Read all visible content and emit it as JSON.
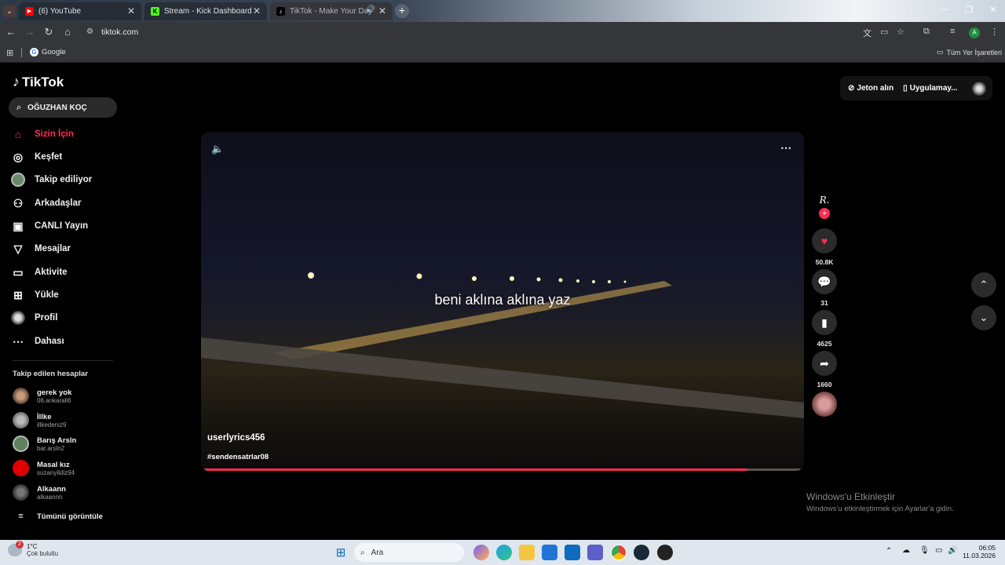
{
  "browser": {
    "tabs": [
      {
        "label": "(6) YouTube",
        "color": "#ff0000",
        "glyph": "▶"
      },
      {
        "label": "Stream - Kick Dashboard",
        "color": "#53fc18",
        "glyph": "K"
      },
      {
        "label": "TikTok - Make Your Day",
        "color": "#000000",
        "glyph": "♪"
      }
    ],
    "url": "tiktok.com",
    "bookmark_google": "Google",
    "bookmark_all": "Tüm Yer İşaretleri",
    "profile_letter": "A"
  },
  "tiktok": {
    "logo": "TikTok",
    "search_value": "OĞUZHAN KOÇ",
    "coins_label": "Jeton alın",
    "app_label": "Uygulamay...",
    "nav": [
      {
        "label": "Sizin İçin",
        "icon": "home-icon"
      },
      {
        "label": "Keşfet",
        "icon": "compass-icon"
      },
      {
        "label": "Takip ediliyor",
        "icon": "following-avatar"
      },
      {
        "label": "Arkadaşlar",
        "icon": "friends-icon"
      },
      {
        "label": "CANLI Yayın",
        "icon": "live-icon"
      },
      {
        "label": "Mesajlar",
        "icon": "messages-icon"
      },
      {
        "label": "Aktivite",
        "icon": "activity-icon"
      },
      {
        "label": "Yükle",
        "icon": "upload-icon"
      },
      {
        "label": "Profil",
        "icon": "profile-avatar"
      },
      {
        "label": "Dahası",
        "icon": "more-icon"
      }
    ],
    "following_title": "Takip edilen hesaplar",
    "following": [
      {
        "name": "gerek yok",
        "handle": "06.ankarali6"
      },
      {
        "name": "İllke",
        "handle": "illkedeniz9"
      },
      {
        "name": "Barış Arsln",
        "handle": "bar.arsln2"
      },
      {
        "name": "Masal kız",
        "handle": "suzanyildiz94"
      },
      {
        "name": "Alkaann",
        "handle": "alkaannn"
      }
    ],
    "see_all": "Tümünü görüntüle",
    "video": {
      "caption": "beni aklına aklına yaz",
      "author": "userlyrics456",
      "hashtag": "#sendensatrlar08",
      "progress": 0.91
    },
    "actions": {
      "likes": "50.8K",
      "comments": "31",
      "saves": "4625",
      "shares": "1660"
    },
    "creator_initial": "R."
  },
  "watermark": {
    "title": "Windows'u Etkinleştir",
    "sub": "Windows'u etkinleştirmek için Ayarlar'a gidin."
  },
  "taskbar": {
    "temp": "1°C",
    "weather": "Çok bulutlu",
    "search": "Ara",
    "time": "06:05",
    "date": "11.03.2026",
    "badge": "2"
  }
}
